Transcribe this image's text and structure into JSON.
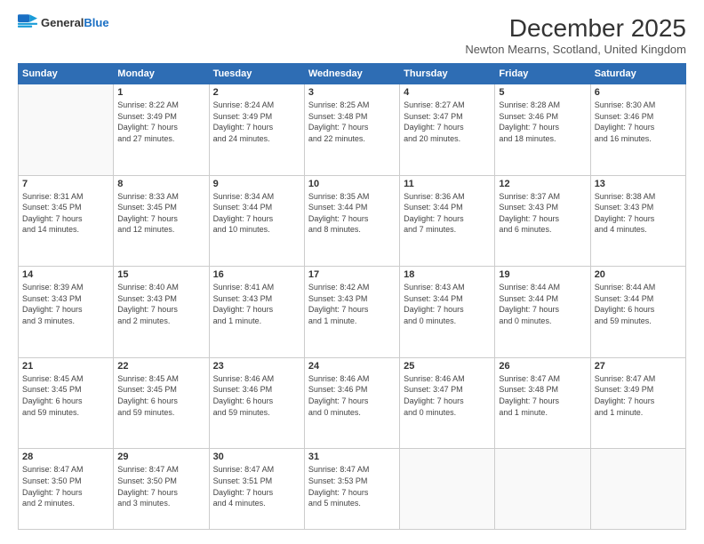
{
  "header": {
    "logo_line1": "General",
    "logo_line2": "Blue",
    "month": "December 2025",
    "location": "Newton Mearns, Scotland, United Kingdom"
  },
  "days_of_week": [
    "Sunday",
    "Monday",
    "Tuesday",
    "Wednesday",
    "Thursday",
    "Friday",
    "Saturday"
  ],
  "weeks": [
    [
      {
        "day": "",
        "info": ""
      },
      {
        "day": "1",
        "info": "Sunrise: 8:22 AM\nSunset: 3:49 PM\nDaylight: 7 hours\nand 27 minutes."
      },
      {
        "day": "2",
        "info": "Sunrise: 8:24 AM\nSunset: 3:49 PM\nDaylight: 7 hours\nand 24 minutes."
      },
      {
        "day": "3",
        "info": "Sunrise: 8:25 AM\nSunset: 3:48 PM\nDaylight: 7 hours\nand 22 minutes."
      },
      {
        "day": "4",
        "info": "Sunrise: 8:27 AM\nSunset: 3:47 PM\nDaylight: 7 hours\nand 20 minutes."
      },
      {
        "day": "5",
        "info": "Sunrise: 8:28 AM\nSunset: 3:46 PM\nDaylight: 7 hours\nand 18 minutes."
      },
      {
        "day": "6",
        "info": "Sunrise: 8:30 AM\nSunset: 3:46 PM\nDaylight: 7 hours\nand 16 minutes."
      }
    ],
    [
      {
        "day": "7",
        "info": "Sunrise: 8:31 AM\nSunset: 3:45 PM\nDaylight: 7 hours\nand 14 minutes."
      },
      {
        "day": "8",
        "info": "Sunrise: 8:33 AM\nSunset: 3:45 PM\nDaylight: 7 hours\nand 12 minutes."
      },
      {
        "day": "9",
        "info": "Sunrise: 8:34 AM\nSunset: 3:44 PM\nDaylight: 7 hours\nand 10 minutes."
      },
      {
        "day": "10",
        "info": "Sunrise: 8:35 AM\nSunset: 3:44 PM\nDaylight: 7 hours\nand 8 minutes."
      },
      {
        "day": "11",
        "info": "Sunrise: 8:36 AM\nSunset: 3:44 PM\nDaylight: 7 hours\nand 7 minutes."
      },
      {
        "day": "12",
        "info": "Sunrise: 8:37 AM\nSunset: 3:43 PM\nDaylight: 7 hours\nand 6 minutes."
      },
      {
        "day": "13",
        "info": "Sunrise: 8:38 AM\nSunset: 3:43 PM\nDaylight: 7 hours\nand 4 minutes."
      }
    ],
    [
      {
        "day": "14",
        "info": "Sunrise: 8:39 AM\nSunset: 3:43 PM\nDaylight: 7 hours\nand 3 minutes."
      },
      {
        "day": "15",
        "info": "Sunrise: 8:40 AM\nSunset: 3:43 PM\nDaylight: 7 hours\nand 2 minutes."
      },
      {
        "day": "16",
        "info": "Sunrise: 8:41 AM\nSunset: 3:43 PM\nDaylight: 7 hours\nand 1 minute."
      },
      {
        "day": "17",
        "info": "Sunrise: 8:42 AM\nSunset: 3:43 PM\nDaylight: 7 hours\nand 1 minute."
      },
      {
        "day": "18",
        "info": "Sunrise: 8:43 AM\nSunset: 3:44 PM\nDaylight: 7 hours\nand 0 minutes."
      },
      {
        "day": "19",
        "info": "Sunrise: 8:44 AM\nSunset: 3:44 PM\nDaylight: 7 hours\nand 0 minutes."
      },
      {
        "day": "20",
        "info": "Sunrise: 8:44 AM\nSunset: 3:44 PM\nDaylight: 6 hours\nand 59 minutes."
      }
    ],
    [
      {
        "day": "21",
        "info": "Sunrise: 8:45 AM\nSunset: 3:45 PM\nDaylight: 6 hours\nand 59 minutes."
      },
      {
        "day": "22",
        "info": "Sunrise: 8:45 AM\nSunset: 3:45 PM\nDaylight: 6 hours\nand 59 minutes."
      },
      {
        "day": "23",
        "info": "Sunrise: 8:46 AM\nSunset: 3:46 PM\nDaylight: 6 hours\nand 59 minutes."
      },
      {
        "day": "24",
        "info": "Sunrise: 8:46 AM\nSunset: 3:46 PM\nDaylight: 7 hours\nand 0 minutes."
      },
      {
        "day": "25",
        "info": "Sunrise: 8:46 AM\nSunset: 3:47 PM\nDaylight: 7 hours\nand 0 minutes."
      },
      {
        "day": "26",
        "info": "Sunrise: 8:47 AM\nSunset: 3:48 PM\nDaylight: 7 hours\nand 1 minute."
      },
      {
        "day": "27",
        "info": "Sunrise: 8:47 AM\nSunset: 3:49 PM\nDaylight: 7 hours\nand 1 minute."
      }
    ],
    [
      {
        "day": "28",
        "info": "Sunrise: 8:47 AM\nSunset: 3:50 PM\nDaylight: 7 hours\nand 2 minutes."
      },
      {
        "day": "29",
        "info": "Sunrise: 8:47 AM\nSunset: 3:50 PM\nDaylight: 7 hours\nand 3 minutes."
      },
      {
        "day": "30",
        "info": "Sunrise: 8:47 AM\nSunset: 3:51 PM\nDaylight: 7 hours\nand 4 minutes."
      },
      {
        "day": "31",
        "info": "Sunrise: 8:47 AM\nSunset: 3:53 PM\nDaylight: 7 hours\nand 5 minutes."
      },
      {
        "day": "",
        "info": ""
      },
      {
        "day": "",
        "info": ""
      },
      {
        "day": "",
        "info": ""
      }
    ]
  ]
}
